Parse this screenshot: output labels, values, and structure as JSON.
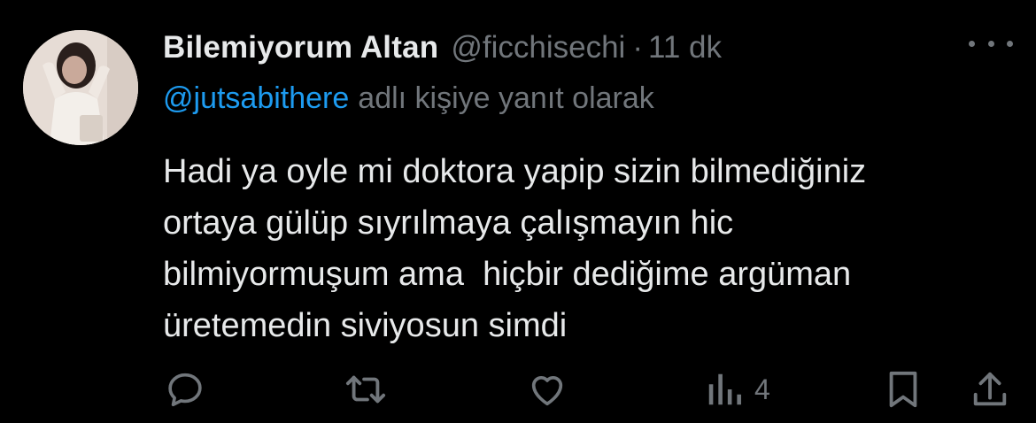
{
  "tweet": {
    "display_name": "Bilemiyorum Altan",
    "handle": "@ficchisechi",
    "separator": "·",
    "time": "11 dk",
    "reply_mention": "@jutsabithere",
    "reply_suffix": "adlı kişiye yanıt olarak",
    "body_lines": [
      "Hadi ya oyle mi doktora yapip sizin bilmediğiniz",
      "ortaya gülüp sıyrılmaya çalışmayın hic",
      "bilmiyormuşum ama  hiçbir dediğime argüman",
      "üretemedin siviyosun simdi"
    ]
  },
  "actions": {
    "views_count": "4",
    "icons": [
      "reply-icon",
      "retweet-icon",
      "like-icon",
      "views-icon",
      "bookmark-icon",
      "share-icon"
    ]
  },
  "colors": {
    "background": "#000000",
    "text": "#e7e9ea",
    "muted": "#71767b",
    "link": "#1d9bf0"
  }
}
